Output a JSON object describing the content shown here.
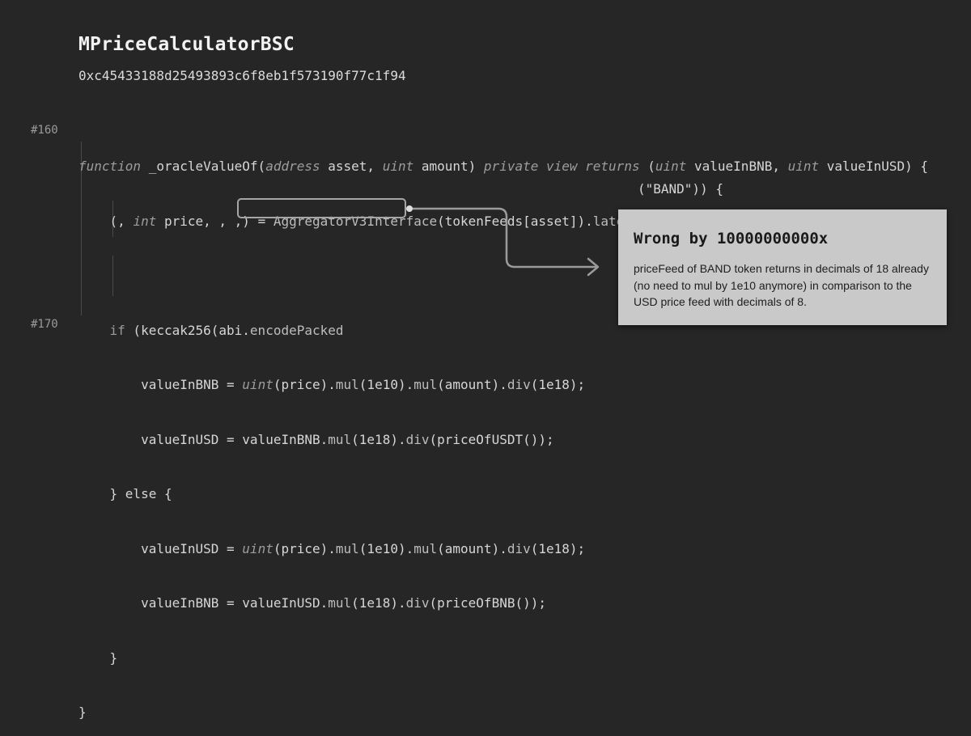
{
  "header": {
    "title": "MPriceCalculatorBSC",
    "address": "0xc45433188d25493893c6f8eb1f573190f77c1f94"
  },
  "line_numbers": {
    "start": "#160",
    "end": "#170"
  },
  "code": {
    "l1": {
      "a": "function",
      "b": " _oracleValueOf(",
      "c": "address",
      "d": " asset, ",
      "e": "uint",
      "f": " amount) ",
      "g": "private view returns",
      "h": " (",
      "i": "uint",
      "j": " valueInBNB, ",
      "k": "uint",
      "l": " valueInUSD) {"
    },
    "l2": {
      "a": "    (, ",
      "b": "int",
      "c": " price, , ,) = ",
      "d": "AggregatorV3Interface",
      "e": "(tokenFeeds[asset]).",
      "f": "latestRoundData",
      "g": "();"
    },
    "l3": {
      "a": "    ",
      "b": "if",
      "c": " (keccak256(abi.",
      "d": "encodePacked"
    },
    "l3_suffix": "(\"BAND\")) {",
    "l4": {
      "a": "        valueInBNB = ",
      "b": "uint",
      "c": "(price).",
      "d": "mul",
      "e": "(1e10).",
      "f": "mul",
      "g": "(amount).",
      "h": "div",
      "i": "(1e18);"
    },
    "l5": {
      "a": "        valueInUSD = valueInBNB.",
      "b": "mul",
      "c": "(1e18).",
      "d": "div",
      "e": "(priceOfUSDT());"
    },
    "l6": {
      "a": "    } ",
      "b": "else",
      "c": " {"
    },
    "l7": {
      "a": "        valueInUSD = ",
      "b": "uint",
      "c": "(price).",
      "d": "mul",
      "e": "(1e10).",
      "f": "mul",
      "g": "(amount).",
      "h": "div",
      "i": "(1e18);"
    },
    "l8": {
      "a": "        valueInBNB = valueInUSD.",
      "b": "mul",
      "c": "(1e18).",
      "d": "div",
      "e": "(priceOfBNB());"
    },
    "l9": "    }",
    "l10": "}"
  },
  "callout": {
    "title": "Wrong by 10000000000x",
    "body": "priceFeed of BAND token returns in decimals of 18 already (no need to mul by 1e10 anymore) in comparison to the USD price feed with decimals of 8."
  },
  "colors": {
    "background": "#262626",
    "callout_bg": "#c9c9c9",
    "highlight": "#a6a6a6"
  }
}
